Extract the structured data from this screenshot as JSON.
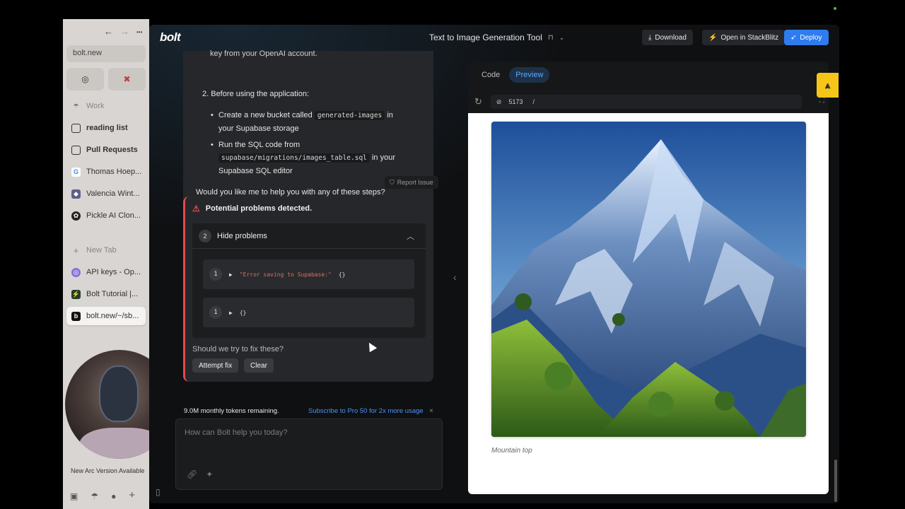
{
  "arc": {
    "nav_back": "←",
    "nav_forward": "→",
    "nav_more": "•••",
    "url": "bolt.new",
    "pinned": [
      {
        "icon": "openai-icon",
        "glyph": "◎"
      },
      {
        "icon": "red-app-icon",
        "glyph": "✖"
      }
    ],
    "items": [
      {
        "label": "Work",
        "icon": "work-icon",
        "glyph": "☂"
      },
      {
        "label": "reading list",
        "icon": "folder-icon",
        "glyph": "▢"
      },
      {
        "label": "Pull Requests",
        "icon": "folder-icon",
        "glyph": "▢"
      },
      {
        "label": "Thomas Hoep...",
        "icon": "google-icon",
        "glyph": "G"
      },
      {
        "label": "Valencia Wint...",
        "icon": "photo-icon",
        "glyph": "◆"
      },
      {
        "label": "Pickle AI Clon...",
        "icon": "pickle-icon",
        "glyph": "✿"
      },
      {
        "label": "New Tab",
        "icon": "plus-icon",
        "glyph": "+"
      },
      {
        "label": "API keys - Op...",
        "icon": "openai-icon",
        "glyph": "◎"
      },
      {
        "label": "Bolt Tutorial |...",
        "icon": "bolt-tutorial-icon",
        "glyph": "⚡"
      },
      {
        "label": "bolt.new/~/sb...",
        "icon": "bolt-icon",
        "glyph": "b"
      }
    ],
    "update_text": "New Arc Version Available"
  },
  "bolt": {
    "logo": "bolt",
    "project_title": "Text to Image Generation Tool",
    "download_label": "Download",
    "stackblitz_label": "Open in StackBlitz",
    "deploy_label": "Deploy"
  },
  "chat": {
    "truncated_line": "key from your OpenAI account.",
    "step2": "2. Before using the application:",
    "bullet1_pre": "Create a new bucket called",
    "bullet1_code": "generated-images",
    "bullet1_post": "in",
    "bullet1_line2": "your Supabase storage",
    "bullet2_pre": "Run the SQL code from",
    "bullet2_code": "supabase/migrations/images_table.sql",
    "bullet2_post": "in your",
    "bullet2_line3": "Supabase SQL editor",
    "question": "Would you like me to help you with any of these steps?",
    "report_issue": "Report Issue"
  },
  "problems": {
    "title": "Potential problems detected.",
    "count": "2",
    "toggle_label": "Hide problems",
    "rows": [
      {
        "count": "1",
        "message": "\"Error saving to Supabase:\"",
        "obj": "{}"
      },
      {
        "count": "1",
        "message": "",
        "obj": "{}"
      }
    ],
    "fix_question": "Should we try to fix these?",
    "attempt_fix": "Attempt fix",
    "clear": "Clear"
  },
  "tokens": {
    "remaining": "9.0M monthly tokens remaining.",
    "upsell": "Subscribe to Pro 50 for 2x more usage",
    "close": "×"
  },
  "prompt": {
    "placeholder": "How can Bolt help you today?"
  },
  "workbench": {
    "tab_code": "Code",
    "tab_preview": "Preview",
    "port": "5173",
    "path": "/",
    "caption": "Mountain top"
  },
  "colors": {
    "accent_blue": "#2f7bf0",
    "error_red": "#e5484d",
    "link_blue": "#4a93f4",
    "arc_bg": "#d9d5d2"
  }
}
